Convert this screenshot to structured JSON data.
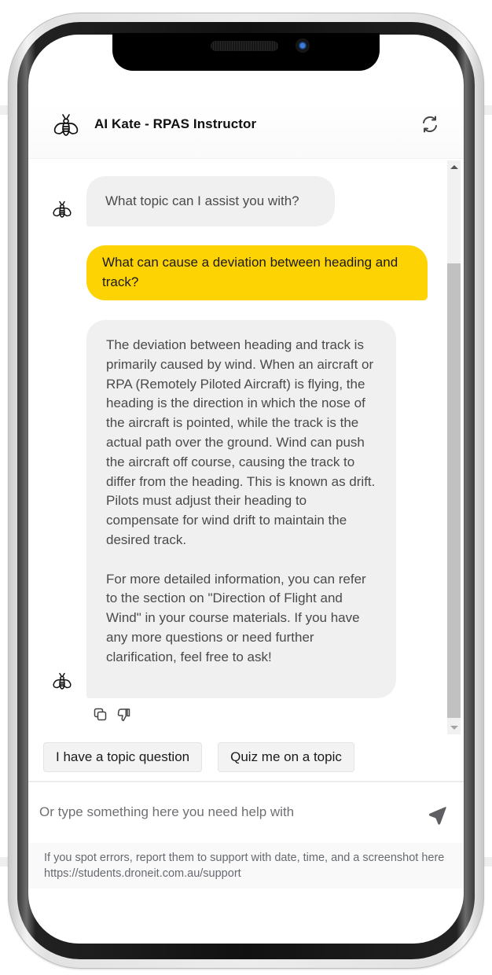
{
  "header": {
    "title": "AI Kate - RPAS Instructor",
    "avatar_icon": "bee-icon",
    "refresh_icon": "refresh-icon"
  },
  "messages": [
    {
      "role": "assistant",
      "text": "What topic can I assist you with?"
    },
    {
      "role": "user",
      "text": "What can cause a deviation between heading and track?"
    },
    {
      "role": "assistant",
      "paragraphs": [
        "The deviation between heading and track is primarily caused by wind. When an air­craft or RPA (Remotely Piloted Aircraft) is flying, the heading is the direction in which the nose of the aircraft is pointed, while the track is the actual path over the ground. Wind can push the aircraft off course, causing the track to differ from the heading. This is known as drift. Pilots must adjust their heading to compensate for wind drift to maintain the desired track.",
        "For more detailed information, you can re­fer to the section on \"Direction of Flight and Wind\" in your course materials. If you have any more questions or need further clarification, feel free to ask!"
      ],
      "actions": [
        {
          "name": "copy",
          "icon": "copy-icon"
        },
        {
          "name": "dislike",
          "icon": "thumbs-down-icon"
        }
      ]
    }
  ],
  "quick_replies": [
    "I have a topic question",
    "Quiz me on a topic"
  ],
  "input": {
    "value": "",
    "placeholder": "Or type something here you need help with",
    "send_icon": "send-icon"
  },
  "footer_note": "If you spot errors, report them to support with date, time, and a screenshot here https://students.droneit.com.au/support",
  "colors": {
    "user_bubble": "#fed303",
    "bot_bubble": "#f0f0f0",
    "footer_bg": "#f9f9f9"
  }
}
